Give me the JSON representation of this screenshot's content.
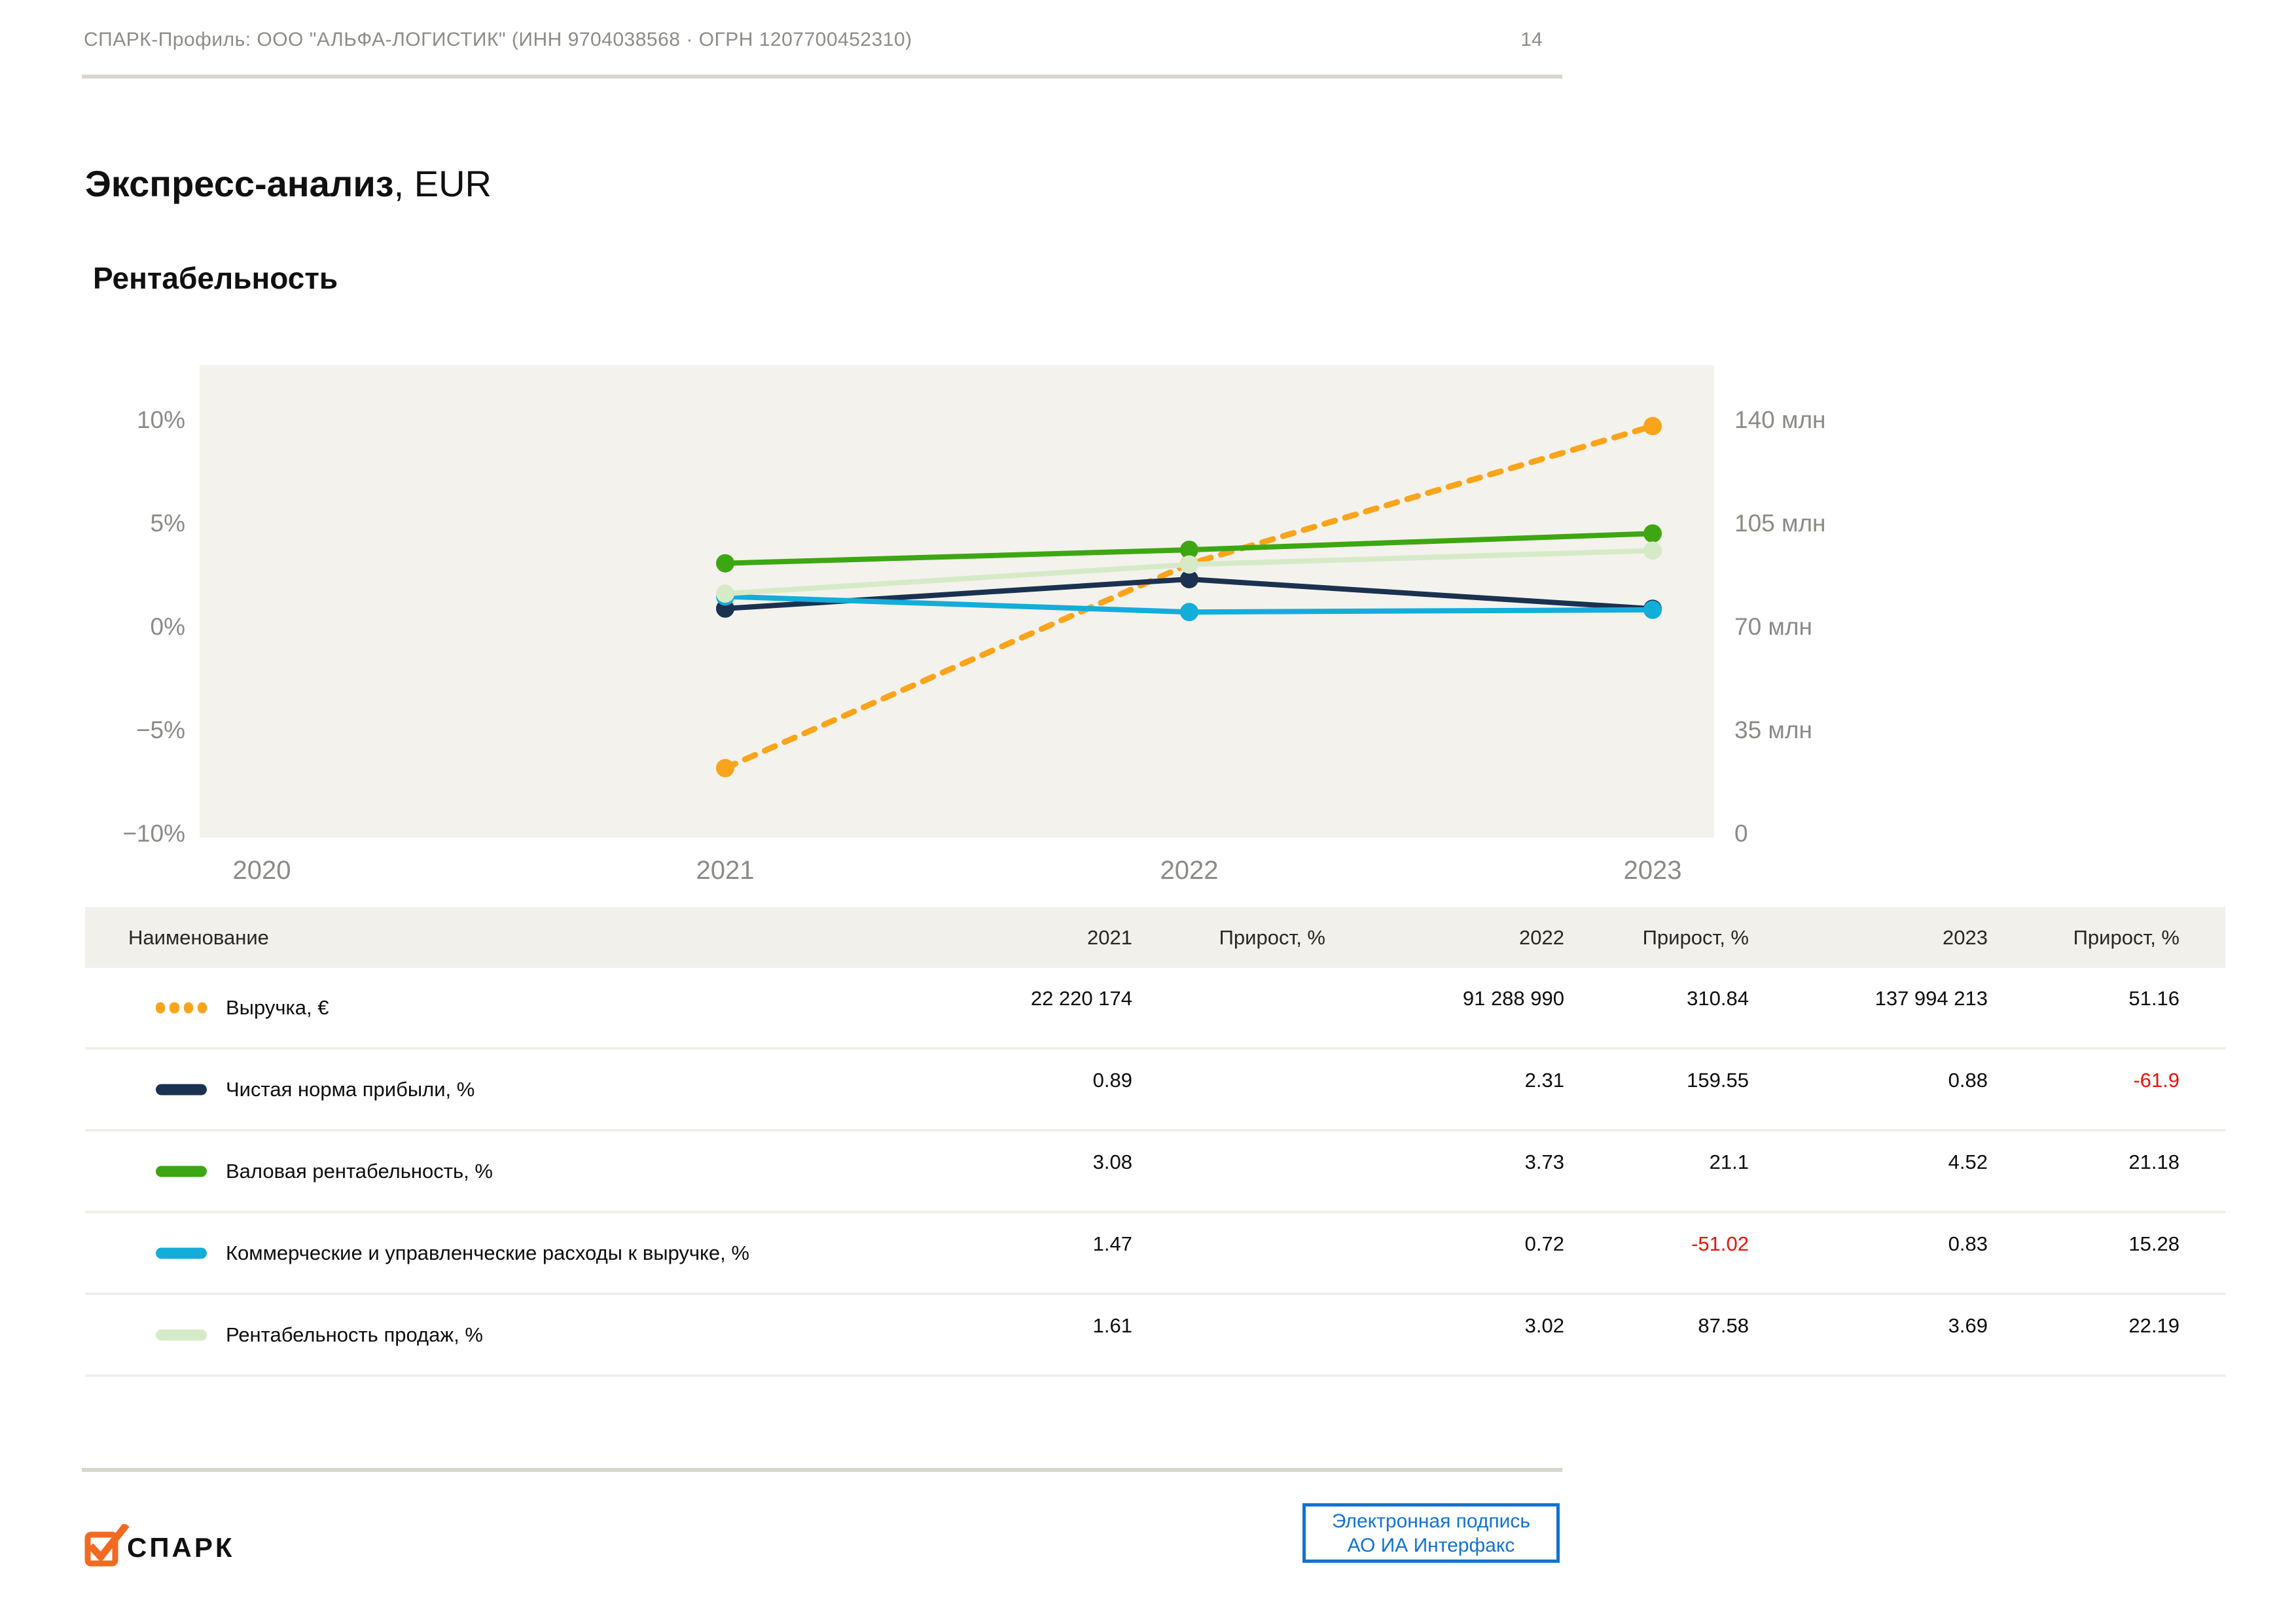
{
  "header": {
    "profile_line": "СПАРК-Профиль: ООО \"АЛЬФА-ЛОГИСТИК\" (ИНН 9704038568 · ОГРН 1207700452310)",
    "page_number": "14"
  },
  "titles": {
    "main": "Экспресс-анализ",
    "main_suffix": ", EUR",
    "section": "Рентабельность"
  },
  "chart_data": {
    "type": "line",
    "x": [
      2021,
      2022,
      2023
    ],
    "x_axis_labels": [
      "2020",
      "2021",
      "2022",
      "2023"
    ],
    "left_axis": {
      "tick_labels": [
        "10%",
        "5%",
        "0%",
        "-5%",
        "-10%"
      ],
      "min": -10,
      "max": 10,
      "unit": "%"
    },
    "right_axis": {
      "tick_labels": [
        "140 млн",
        "105 млн",
        "70 млн",
        "35 млн",
        "0"
      ],
      "min": 0,
      "max": 140000000,
      "unit": "EUR"
    },
    "grid": false,
    "legend_position": "table-below",
    "series": [
      {
        "name": "Выручка, €",
        "axis": "right",
        "style": "dashed",
        "color": "#F9A41B",
        "values": [
          22220174,
          91288990,
          137994213
        ]
      },
      {
        "name": "Валовая рентабельность, %",
        "axis": "left",
        "style": "solid",
        "color": "#3DA713",
        "values": [
          3.08,
          3.73,
          4.52
        ]
      },
      {
        "name": "Чистая норма прибыли, %",
        "axis": "left",
        "style": "solid",
        "color": "#1B3150",
        "values": [
          0.89,
          2.31,
          0.88
        ]
      },
      {
        "name": "Коммерческие и управленческие расходы к выручке, %",
        "axis": "left",
        "style": "solid",
        "color": "#13ADDA",
        "values": [
          1.47,
          0.72,
          0.83
        ]
      },
      {
        "name": "Рентабельность продаж, %",
        "axis": "left",
        "style": "solid",
        "color": "#D6EAC8",
        "values": [
          1.61,
          3.02,
          3.69
        ]
      }
    ]
  },
  "table": {
    "columns": [
      "Наименование",
      "2021",
      "Прирост, %",
      "2022",
      "Прирост, %",
      "2023",
      "Прирост, %"
    ],
    "rows": [
      {
        "name": "Выручка, €",
        "swatch_color": "#F9A41B",
        "swatch_dashed": true,
        "values": [
          "22 220 174",
          "",
          "91 288 990",
          "310.84",
          "137 994 213",
          "51.16"
        ]
      },
      {
        "name": "Чистая норма прибыли, %",
        "swatch_color": "#1B3150",
        "swatch_dashed": false,
        "values": [
          "0.89",
          "",
          "2.31",
          "159.55",
          "0.88",
          "-61.9"
        ]
      },
      {
        "name": "Валовая рентабельность, %",
        "swatch_color": "#3DA713",
        "swatch_dashed": false,
        "values": [
          "3.08",
          "",
          "3.73",
          "21.1",
          "4.52",
          "21.18"
        ]
      },
      {
        "name": "Коммерческие и управленческие расходы к выручке, %",
        "swatch_color": "#13ADDA",
        "swatch_dashed": false,
        "values": [
          "1.47",
          "",
          "0.72",
          "-51.02",
          "0.83",
          "15.28"
        ]
      },
      {
        "name": "Рентабельность продаж, %",
        "swatch_color": "#D6EAC8",
        "swatch_dashed": false,
        "values": [
          "1.61",
          "",
          "3.02",
          "87.58",
          "3.69",
          "22.19"
        ]
      }
    ]
  },
  "footer": {
    "logo_text": "СПАРК",
    "signature_line1": "Электронная подпись",
    "signature_line2": "АО ИА Интерфакс"
  },
  "colors": {
    "accent_orange": "#F26A21",
    "signature_blue": "#1173cf",
    "negative_red": "#ea120c",
    "plot_background": "#f4f2ec",
    "table_header_background": "#f2f0ea",
    "rule_gray": "#d9d6cd",
    "muted_text": "#8e8c87"
  }
}
